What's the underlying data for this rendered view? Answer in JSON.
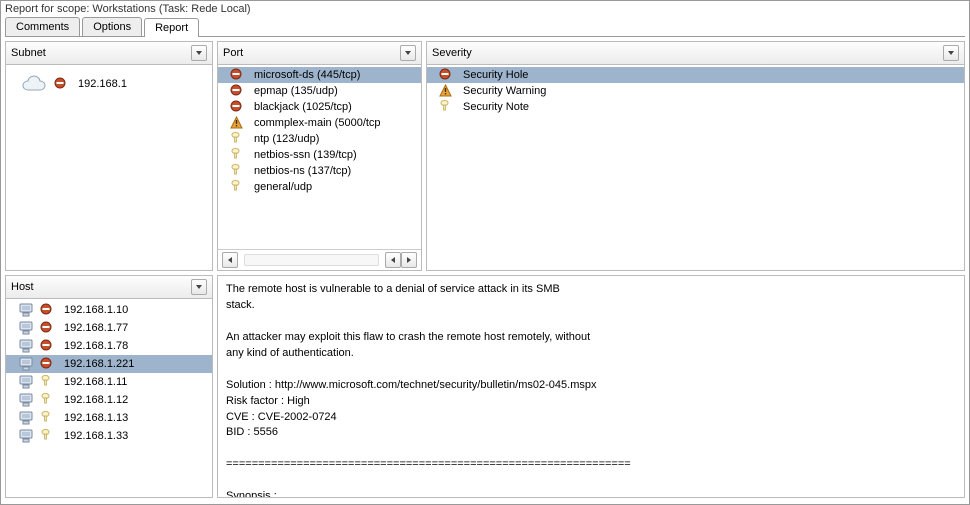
{
  "title": "Report for scope: Workstations (Task: Rede Local)",
  "tabs": [
    {
      "label": "Comments",
      "active": false
    },
    {
      "label": "Options",
      "active": false
    },
    {
      "label": "Report",
      "active": true
    }
  ],
  "subnet": {
    "header": "Subnet",
    "items": [
      {
        "label": "192.168.1",
        "severity": "hole",
        "selected": false
      }
    ]
  },
  "host": {
    "header": "Host",
    "items": [
      {
        "label": "192.168.1.10",
        "severity": "hole",
        "selected": false
      },
      {
        "label": "192.168.1.77",
        "severity": "hole",
        "selected": false
      },
      {
        "label": "192.168.1.78",
        "severity": "hole",
        "selected": false
      },
      {
        "label": "192.168.1.221",
        "severity": "hole",
        "selected": true
      },
      {
        "label": "192.168.1.11",
        "severity": "note",
        "selected": false
      },
      {
        "label": "192.168.1.12",
        "severity": "note",
        "selected": false
      },
      {
        "label": "192.168.1.13",
        "severity": "note",
        "selected": false
      },
      {
        "label": "192.168.1.33",
        "severity": "note",
        "selected": false
      }
    ]
  },
  "port": {
    "header": "Port",
    "items": [
      {
        "label": "microsoft-ds (445/tcp)",
        "severity": "hole",
        "selected": true
      },
      {
        "label": "epmap (135/udp)",
        "severity": "hole",
        "selected": false
      },
      {
        "label": "blackjack (1025/tcp)",
        "severity": "hole",
        "selected": false
      },
      {
        "label": "commplex-main (5000/tcp",
        "severity": "warning",
        "selected": false
      },
      {
        "label": "ntp (123/udp)",
        "severity": "note",
        "selected": false
      },
      {
        "label": "netbios-ssn (139/tcp)",
        "severity": "note",
        "selected": false
      },
      {
        "label": "netbios-ns (137/tcp)",
        "severity": "note",
        "selected": false
      },
      {
        "label": "general/udp",
        "severity": "note",
        "selected": false
      }
    ]
  },
  "severity": {
    "header": "Severity",
    "items": [
      {
        "label": "Security Hole",
        "severity": "hole",
        "selected": true
      },
      {
        "label": "Security Warning",
        "severity": "warning",
        "selected": false
      },
      {
        "label": "Security Note",
        "severity": "note",
        "selected": false
      }
    ]
  },
  "detail": "The remote host is vulnerable to a denial of service attack in its SMB\nstack.\n\nAn attacker may exploit this flaw to crash the remote host remotely, without\nany kind of authentication.\n\nSolution : http://www.microsoft.com/technet/security/bulletin/ms02-045.mspx\nRisk factor : High\nCVE : CVE-2002-0724\nBID : 5556\n\n===============================================================\n\nSynopsis :\n\nIt is possible to access a network share.\n\nDescription :"
}
